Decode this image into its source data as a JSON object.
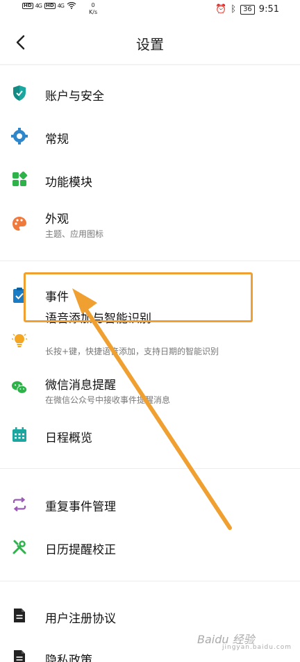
{
  "status_bar": {
    "left_network": [
      "HD",
      "4G",
      "HD",
      "4G"
    ],
    "speed_value": "0",
    "speed_unit": "K/s",
    "battery": "36",
    "time": "9:51"
  },
  "header": {
    "title": "设置"
  },
  "groups": {
    "group1": [
      {
        "label": "账户与安全",
        "icon": "shield-icon",
        "color": "#1ba7a0"
      },
      {
        "label": "常规",
        "icon": "gear-icon",
        "color": "#2f86c8"
      },
      {
        "label": "功能模块",
        "icon": "modules-icon",
        "color": "#2db34a"
      },
      {
        "label": "外观",
        "sub": "主题、应用图标",
        "icon": "palette-icon",
        "color": "#f07a3c"
      }
    ],
    "group2": [
      {
        "label": "事件",
        "icon": "clipboard-check-icon",
        "color": "#1a7cc4"
      },
      {
        "label": "语音添加与智能识别",
        "sub": "长按+键，快捷语音添加，支持日期的智能识别",
        "icon": "lightbulb-icon",
        "color": "#f4a623"
      },
      {
        "label": "微信消息提醒",
        "sub": "在微信公众号中接收事件提醒消息",
        "icon": "wechat-icon",
        "color": "#2db34a"
      },
      {
        "label": "日程概览",
        "icon": "calendar-icon",
        "color": "#1ba7a0"
      }
    ],
    "group3": [
      {
        "label": "重复事件管理",
        "icon": "repeat-icon",
        "color": "#9b59b6"
      },
      {
        "label": "日历提醒校正",
        "icon": "tools-icon",
        "color": "#2db34a"
      }
    ],
    "group4": [
      {
        "label": "用户注册协议",
        "icon": "document-icon",
        "color": "#222222"
      },
      {
        "label": "隐私政策",
        "icon": "document-icon",
        "color": "#222222"
      }
    ]
  },
  "annotation": {
    "highlight_color": "#f0a030"
  },
  "watermark": {
    "text": "Baidu 经验",
    "sub": "jingyan.baidu.com"
  }
}
